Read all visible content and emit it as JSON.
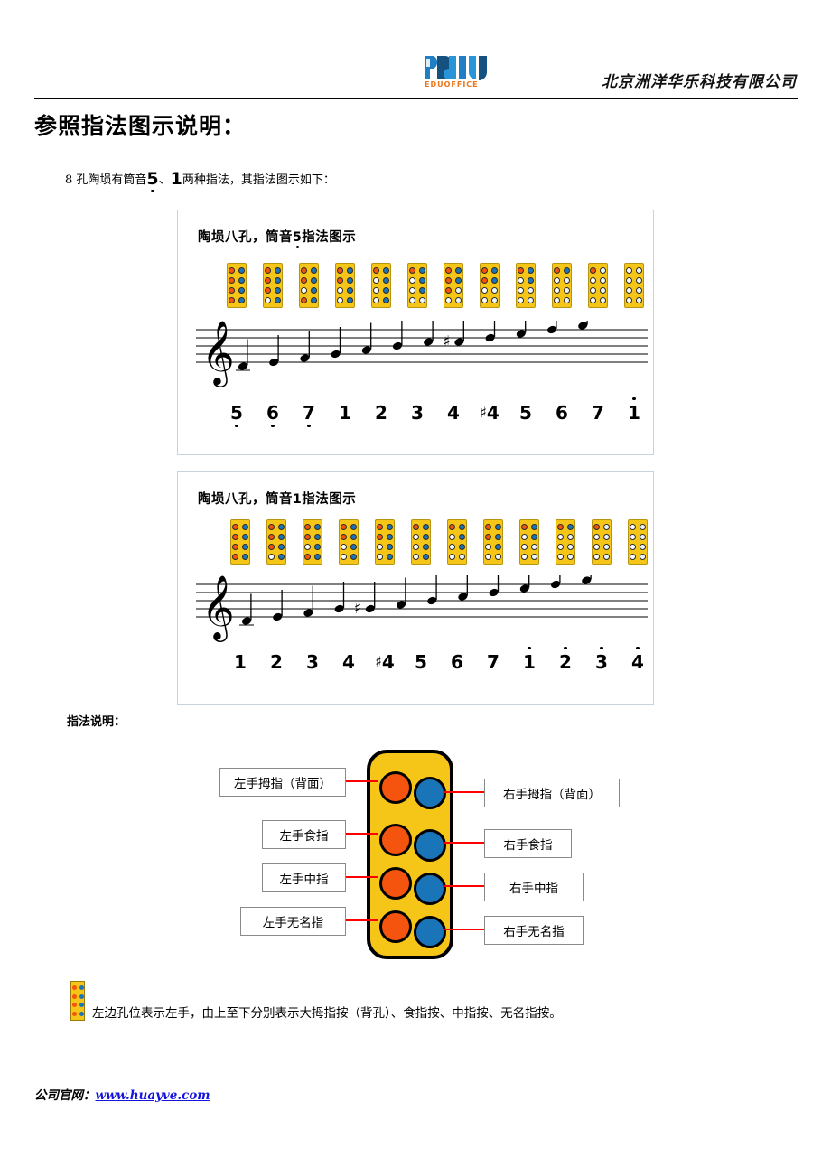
{
  "header": {
    "logo_text": "EDUOFFICE",
    "logo_icon": "eduoffice-logo",
    "company_name": "北京洲洋华乐科技有限公司"
  },
  "title": "参照指法图示说明：",
  "intro": {
    "prefix": "8 孔陶埙有筒音",
    "note_a": "5",
    "separator": "、",
    "note_b": "1",
    "suffix": "两种指法，其指法图示如下："
  },
  "figure1": {
    "title_prefix": "陶埙八孔，筒音",
    "title_note": "5",
    "title_suffix": "指法图示",
    "numbers": [
      {
        "text": "5",
        "octave": "low",
        "sharp": false
      },
      {
        "text": "6",
        "octave": "low",
        "sharp": false
      },
      {
        "text": "7",
        "octave": "low",
        "sharp": false
      },
      {
        "text": "1",
        "octave": "mid",
        "sharp": false
      },
      {
        "text": "2",
        "octave": "mid",
        "sharp": false
      },
      {
        "text": "3",
        "octave": "mid",
        "sharp": false
      },
      {
        "text": "4",
        "octave": "mid",
        "sharp": false
      },
      {
        "text": "4",
        "octave": "mid",
        "sharp": true
      },
      {
        "text": "5",
        "octave": "mid",
        "sharp": false
      },
      {
        "text": "6",
        "octave": "mid",
        "sharp": false
      },
      {
        "text": "7",
        "octave": "mid",
        "sharp": false
      },
      {
        "text": "1",
        "octave": "high",
        "sharp": false
      }
    ],
    "fingerings": [
      [
        [
          1,
          1
        ],
        [
          1,
          1
        ],
        [
          1,
          1
        ],
        [
          1,
          1
        ]
      ],
      [
        [
          1,
          1
        ],
        [
          1,
          1
        ],
        [
          1,
          1
        ],
        [
          0,
          1
        ]
      ],
      [
        [
          1,
          1
        ],
        [
          1,
          1
        ],
        [
          0,
          1
        ],
        [
          1,
          1
        ]
      ],
      [
        [
          1,
          1
        ],
        [
          1,
          1
        ],
        [
          0,
          1
        ],
        [
          0,
          1
        ]
      ],
      [
        [
          1,
          1
        ],
        [
          0,
          1
        ],
        [
          0,
          1
        ],
        [
          0,
          1
        ]
      ],
      [
        [
          1,
          1
        ],
        [
          0,
          1
        ],
        [
          0,
          1
        ],
        [
          0,
          0
        ]
      ],
      [
        [
          1,
          1
        ],
        [
          1,
          1
        ],
        [
          1,
          0
        ],
        [
          0,
          0
        ]
      ],
      [
        [
          1,
          1
        ],
        [
          1,
          1
        ],
        [
          0,
          0
        ],
        [
          0,
          0
        ]
      ],
      [
        [
          1,
          1
        ],
        [
          0,
          1
        ],
        [
          0,
          0
        ],
        [
          0,
          0
        ]
      ],
      [
        [
          1,
          1
        ],
        [
          0,
          0
        ],
        [
          0,
          0
        ],
        [
          0,
          0
        ]
      ],
      [
        [
          1,
          0
        ],
        [
          0,
          0
        ],
        [
          0,
          0
        ],
        [
          0,
          0
        ]
      ],
      [
        [
          0,
          0
        ],
        [
          0,
          0
        ],
        [
          0,
          0
        ],
        [
          0,
          0
        ]
      ]
    ],
    "staff_note_steps": [
      0,
      1,
      2,
      3,
      4,
      5,
      6,
      6,
      7,
      8,
      9,
      10
    ],
    "sharp_indices": [
      7
    ]
  },
  "figure2": {
    "title_prefix": "陶埙八孔，筒音",
    "title_note": "1",
    "title_suffix": "指法图示",
    "numbers": [
      {
        "text": "1",
        "octave": "mid",
        "sharp": false
      },
      {
        "text": "2",
        "octave": "mid",
        "sharp": false
      },
      {
        "text": "3",
        "octave": "mid",
        "sharp": false
      },
      {
        "text": "4",
        "octave": "mid",
        "sharp": false
      },
      {
        "text": "4",
        "octave": "mid",
        "sharp": true
      },
      {
        "text": "5",
        "octave": "mid",
        "sharp": false
      },
      {
        "text": "6",
        "octave": "mid",
        "sharp": false
      },
      {
        "text": "7",
        "octave": "mid",
        "sharp": false
      },
      {
        "text": "1",
        "octave": "high",
        "sharp": false
      },
      {
        "text": "2",
        "octave": "high",
        "sharp": false
      },
      {
        "text": "3",
        "octave": "high",
        "sharp": false
      },
      {
        "text": "4",
        "octave": "high",
        "sharp": false
      }
    ],
    "fingerings": [
      [
        [
          1,
          1
        ],
        [
          1,
          1
        ],
        [
          1,
          1
        ],
        [
          1,
          1
        ]
      ],
      [
        [
          1,
          1
        ],
        [
          1,
          1
        ],
        [
          1,
          1
        ],
        [
          0,
          1
        ]
      ],
      [
        [
          1,
          1
        ],
        [
          1,
          1
        ],
        [
          0,
          1
        ],
        [
          1,
          1
        ]
      ],
      [
        [
          1,
          1
        ],
        [
          1,
          1
        ],
        [
          0,
          1
        ],
        [
          0,
          1
        ]
      ],
      [
        [
          1,
          1
        ],
        [
          1,
          1
        ],
        [
          0,
          1
        ],
        [
          0,
          1
        ]
      ],
      [
        [
          1,
          1
        ],
        [
          0,
          1
        ],
        [
          0,
          1
        ],
        [
          0,
          1
        ]
      ],
      [
        [
          1,
          1
        ],
        [
          0,
          1
        ],
        [
          0,
          1
        ],
        [
          0,
          0
        ]
      ],
      [
        [
          1,
          1
        ],
        [
          1,
          1
        ],
        [
          0,
          1
        ],
        [
          0,
          0
        ]
      ],
      [
        [
          1,
          1
        ],
        [
          0,
          1
        ],
        [
          0,
          0
        ],
        [
          0,
          0
        ]
      ],
      [
        [
          1,
          1
        ],
        [
          0,
          0
        ],
        [
          0,
          0
        ],
        [
          0,
          0
        ]
      ],
      [
        [
          1,
          0
        ],
        [
          0,
          0
        ],
        [
          0,
          0
        ],
        [
          0,
          0
        ]
      ],
      [
        [
          0,
          0
        ],
        [
          0,
          0
        ],
        [
          0,
          0
        ],
        [
          0,
          0
        ]
      ]
    ],
    "staff_note_steps": [
      0,
      1,
      2,
      3,
      3,
      4,
      5,
      6,
      7,
      8,
      9,
      10
    ],
    "sharp_indices": [
      4
    ]
  },
  "legend": {
    "heading": "指法说明：",
    "left_labels": [
      "左手拇指（背面）",
      "左手食指",
      "左手中指",
      "左手无名指"
    ],
    "right_labels": [
      "右手拇指（背面）",
      "右手食指",
      "右手中指",
      "右手无名指"
    ]
  },
  "caption": "左边孔位表示左手，由上至下分别表示大拇指按（背孔）、食指按、中指按、无名指按。",
  "footer": {
    "label": "公司官网：",
    "url": "www.huayve.com"
  },
  "colors": {
    "left_hole_filled": "#f4540d",
    "right_hole_filled": "#1a74b8",
    "hole_open": "#ffffff",
    "chip_body": "#f5c518",
    "leader_line": "#ff0000",
    "link": "#1414dd",
    "logo_blue": "#1f7ec4",
    "logo_orange": "#e8761a"
  }
}
